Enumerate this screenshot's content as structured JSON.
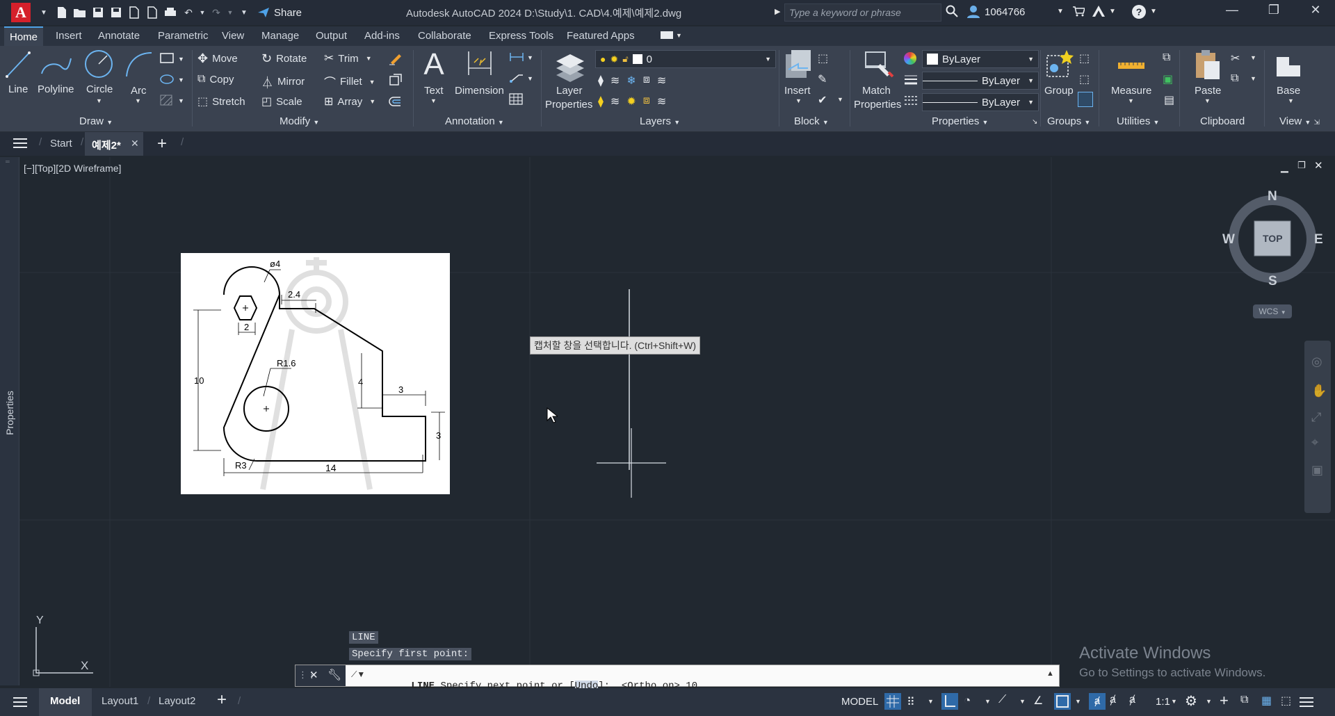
{
  "app": {
    "title": "Autodesk AutoCAD 2024    D:\\Study\\1. CAD\\4.예제\\예제2.dwg",
    "share_label": "Share",
    "search_placeholder": "Type a keyword or phrase",
    "user": "1064766"
  },
  "ribbon_tabs": [
    "Home",
    "Insert",
    "Annotate",
    "Parametric",
    "View",
    "Manage",
    "Output",
    "Add-ins",
    "Collaborate",
    "Express Tools",
    "Featured Apps"
  ],
  "draw": {
    "line": "Line",
    "polyline": "Polyline",
    "circle": "Circle",
    "arc": "Arc",
    "panel": "Draw"
  },
  "modify": {
    "move": "Move",
    "rotate": "Rotate",
    "trim": "Trim",
    "copy": "Copy",
    "mirror": "Mirror",
    "fillet": "Fillet",
    "stretch": "Stretch",
    "scale": "Scale",
    "array": "Array",
    "panel": "Modify"
  },
  "annotation": {
    "text": "Text",
    "dimension": "Dimension",
    "panel": "Annotation"
  },
  "layers": {
    "layer_properties_1": "Layer",
    "layer_properties_2": "Properties",
    "current_layer": "0",
    "panel": "Layers"
  },
  "block": {
    "insert": "Insert",
    "panel": "Block"
  },
  "properties": {
    "match_1": "Match",
    "match_2": "Properties",
    "color": "ByLayer",
    "linetype": "ByLayer",
    "lineweight": "ByLayer",
    "panel": "Properties"
  },
  "groups": {
    "group": "Group",
    "panel": "Groups"
  },
  "utilities": {
    "measure": "Measure",
    "panel": "Utilities"
  },
  "clipboard": {
    "paste": "Paste",
    "panel": "Clipboard"
  },
  "view": {
    "base": "Base",
    "panel": "View"
  },
  "file_tabs": {
    "start": "Start",
    "current": "예제2*"
  },
  "viewport": {
    "label": "[−][Top][2D Wireframe]",
    "properties_palette": "Properties"
  },
  "viewcube": {
    "n": "N",
    "s": "S",
    "e": "E",
    "w": "W",
    "top": "TOP",
    "wcs": "WCS"
  },
  "tooltip": "캡처할 창을 선택합니다. (Ctrl+Shift+W)",
  "reference_drawing": {
    "dims": {
      "d4": "ø4",
      "d24": "2.4",
      "d2": "2",
      "r16": "R1.6",
      "d10": "10",
      "d4v": "4",
      "d3h": "3",
      "d3v": "3",
      "r3": "R3",
      "d14": "14"
    }
  },
  "command": {
    "history_1": "LINE",
    "history_2": "Specify first point:",
    "cmd_name": "LINE",
    "prompt_pre": "Specify next point or [",
    "prompt_opt": "Undo",
    "prompt_post": "]:  <Ortho on> 10"
  },
  "watermark": {
    "line1": "Activate Windows",
    "line2": "Go to Settings to activate Windows."
  },
  "status_bar": {
    "model_tab": "Model",
    "layout1": "Layout1",
    "layout2": "Layout2",
    "model_space": "MODEL",
    "scale": "1:1"
  },
  "ucs": {
    "x": "X",
    "y": "Y"
  }
}
